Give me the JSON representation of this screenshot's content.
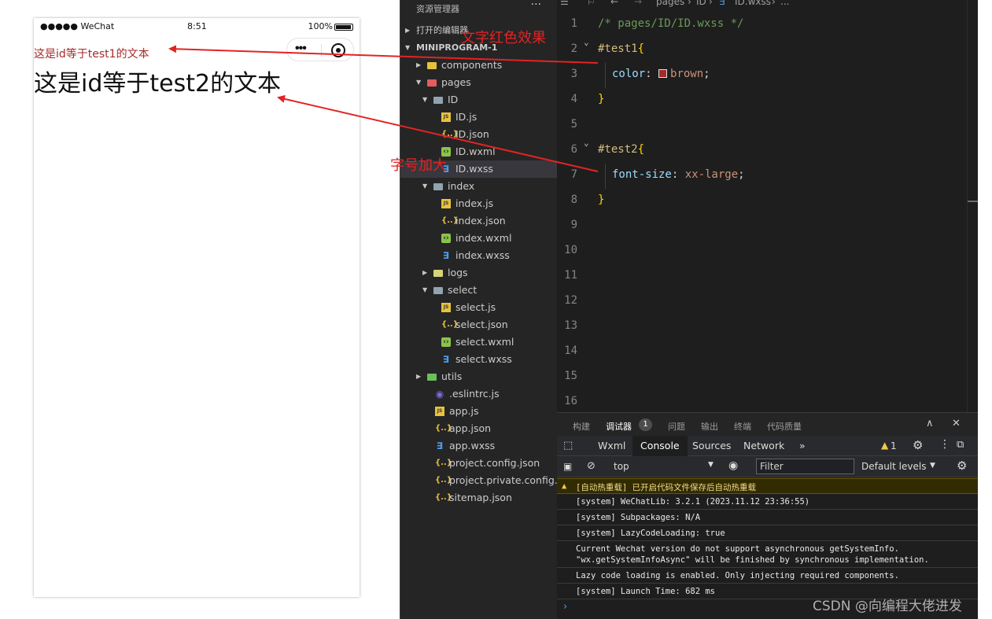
{
  "simulator": {
    "status": {
      "carrier": "●●●●● WeChat",
      "time": "8:51",
      "battery": "100%"
    },
    "capsule": {
      "more_icon": "more-dots-icon",
      "record_icon": "record-icon"
    },
    "content": {
      "test1_text": "这是id等于test1的文本",
      "test2_text": "这是id等于test2的文本"
    }
  },
  "explorer": {
    "title": "资源管理器",
    "more": "···",
    "open_editors": "打开的编辑器",
    "project": "MINIPROGRAM-1",
    "tree": [
      {
        "label": "components",
        "icon": "components-folder-icon"
      },
      {
        "label": "pages",
        "icon": "pages-folder-icon"
      },
      {
        "label": "ID",
        "icon": "folder-open-icon"
      },
      {
        "label": "ID.js",
        "icon": "js-file-icon"
      },
      {
        "label": "ID.json",
        "icon": "json-file-icon"
      },
      {
        "label": "ID.wxml",
        "icon": "wxml-file-icon"
      },
      {
        "label": "ID.wxss",
        "icon": "wxss-file-icon"
      },
      {
        "label": "index",
        "icon": "folder-open-icon"
      },
      {
        "label": "index.js",
        "icon": "js-file-icon"
      },
      {
        "label": "index.json",
        "icon": "json-file-icon"
      },
      {
        "label": "index.wxml",
        "icon": "wxml-file-icon"
      },
      {
        "label": "index.wxss",
        "icon": "wxss-file-icon"
      },
      {
        "label": "logs",
        "icon": "folder-icon"
      },
      {
        "label": "select",
        "icon": "folder-open-icon"
      },
      {
        "label": "select.js",
        "icon": "js-file-icon"
      },
      {
        "label": "select.json",
        "icon": "json-file-icon"
      },
      {
        "label": "select.wxml",
        "icon": "wxml-file-icon"
      },
      {
        "label": "select.wxss",
        "icon": "wxss-file-icon"
      },
      {
        "label": "utils",
        "icon": "folder-icon"
      },
      {
        "label": ".eslintrc.js",
        "icon": "eslint-file-icon"
      },
      {
        "label": "app.js",
        "icon": "js-file-icon"
      },
      {
        "label": "app.json",
        "icon": "json-file-icon"
      },
      {
        "label": "app.wxss",
        "icon": "wxss-file-icon"
      },
      {
        "label": "project.config.json",
        "icon": "json-file-icon"
      },
      {
        "label": "project.private.config.js...",
        "icon": "json-file-icon"
      },
      {
        "label": "sitemap.json",
        "icon": "json-file-icon"
      }
    ],
    "selected": "ID.wxss"
  },
  "editor": {
    "breadcrumb": [
      "pages",
      "ID",
      "ID.wxss",
      "..."
    ],
    "line_numbers": [
      "1",
      "2",
      "3",
      "4",
      "5",
      "6",
      "7",
      "8",
      "9",
      "10",
      "11",
      "12",
      "13",
      "14",
      "15",
      "16"
    ],
    "code": {
      "l1": "/* pages/ID/ID.wxss */",
      "l2_sel": "#test1",
      "brace_open": "{",
      "brace_close": "}",
      "l3_prop": "color",
      "l3_val": "brown",
      "colon": ": ",
      "semi": ";",
      "l6_sel": "#test2",
      "l7_prop": "font-size",
      "l7_val": "xx-large"
    },
    "swatch_color": "#a52a2a"
  },
  "panel": {
    "tabs": [
      {
        "label": "构建"
      },
      {
        "label": "调试器",
        "active": true,
        "badge": "1"
      },
      {
        "label": "问题"
      },
      {
        "label": "输出"
      },
      {
        "label": "终端"
      },
      {
        "label": "代码质量"
      }
    ],
    "collapse_icon": "chevron-up-icon",
    "close_icon": "close-icon",
    "devtools_tabs": [
      "Wxml",
      "Console",
      "Sources",
      "Network"
    ],
    "devtools_active": "Console",
    "more_tabs": "»",
    "warning_count": "1",
    "context": "top",
    "filter_placeholder": "Filter",
    "levels": "Default levels",
    "logs": [
      {
        "type": "warn",
        "text": "[自动热重载] 已开启代码文件保存后自动热重载"
      },
      {
        "type": "info",
        "text": "[system] WeChatLib: 3.2.1 (2023.11.12 23:36:55)"
      },
      {
        "type": "info",
        "text": "[system] Subpackages: N/A"
      },
      {
        "type": "info",
        "text": "[system] LazyCodeLoading: true"
      },
      {
        "type": "info",
        "text": "Current Wechat version do not support asynchronous getSystemInfo.\n\"wx.getSystemInfoAsync\" will be finished by synchronous implementation."
      },
      {
        "type": "info",
        "text": "Lazy code loading is enabled. Only injecting required components."
      },
      {
        "type": "info",
        "text": "[system] Launch Time: 682 ms"
      }
    ],
    "prompt": "›"
  },
  "annotations": {
    "red_effect": "文字红色效果",
    "font_bigger": "字号加大",
    "color": "#e32323"
  },
  "watermark": "CSDN @向编程大佬进发"
}
